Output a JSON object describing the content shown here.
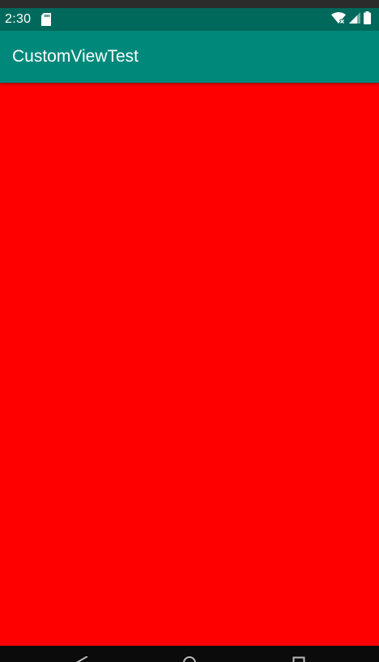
{
  "status_bar": {
    "time": "2:30",
    "icons": [
      "sd-card-icon",
      "wifi-icon",
      "signal-icon",
      "battery-icon"
    ]
  },
  "app_bar": {
    "title": "CustomViewTest"
  },
  "content": {
    "background_color": "#ff0000"
  },
  "nav_bar": {
    "icons": [
      "back-icon",
      "home-icon",
      "recents-icon"
    ]
  },
  "colors": {
    "status_bar": "#00695c",
    "app_bar": "#00897b",
    "content": "#ff0000"
  }
}
